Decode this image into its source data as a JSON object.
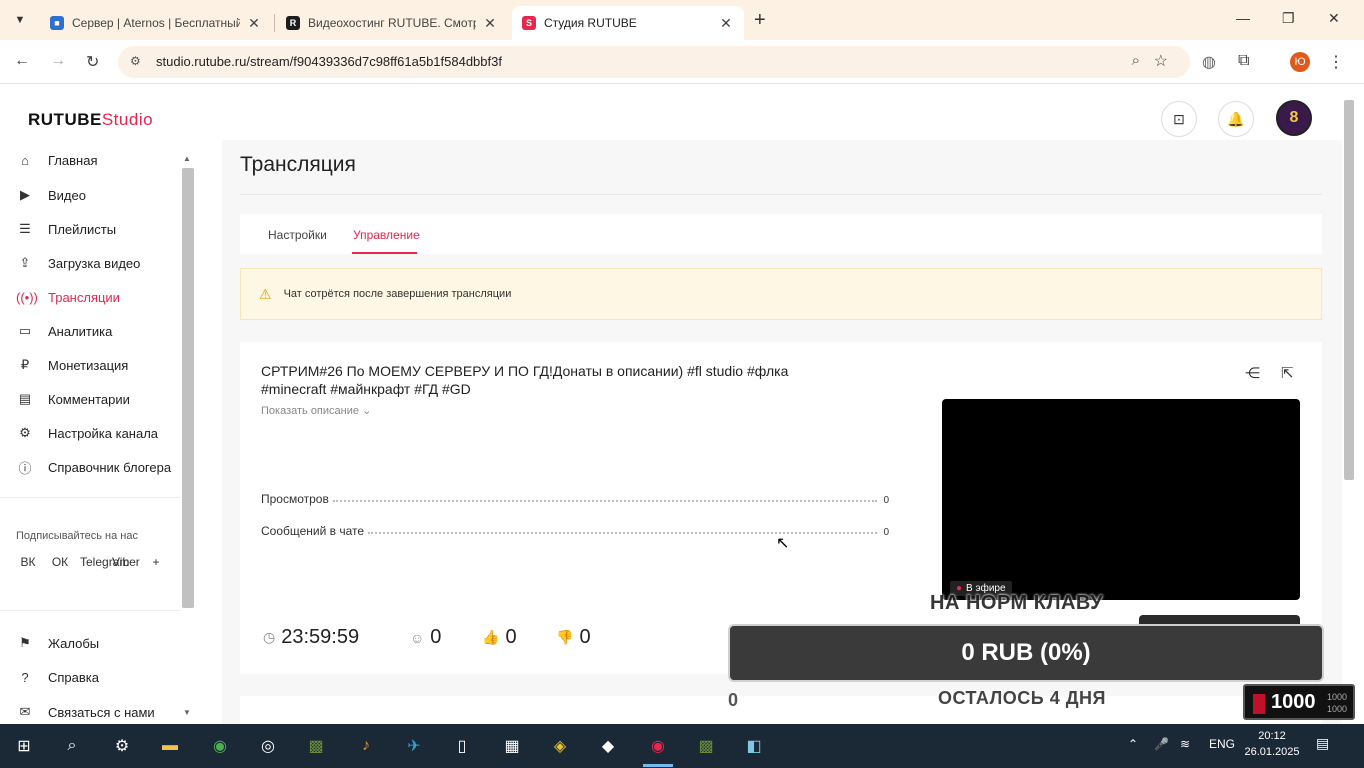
{
  "browser": {
    "tabs": [
      {
        "title": "Сервер | Aternos | Бесплатный",
        "favicon": "aternos-icon",
        "color": "#2f6fd1"
      },
      {
        "title": "Видеохостинг RUTUBE. Смотри",
        "favicon": "rutube-icon",
        "color": "#1d1d1d"
      },
      {
        "title": "Студия RUTUBE",
        "favicon": "rutube-studio-icon",
        "color": "#e8264e"
      }
    ],
    "url": "studio.rutube.ru/stream/f90439336d7c98ff61a5b1f584dbbf3f",
    "profile_letter": "Ю"
  },
  "app": {
    "logo_main": "RUTUBE",
    "logo_sub": "Studio",
    "brand_color": "#e8264e"
  },
  "sidebar": {
    "items": [
      {
        "label": "Главная",
        "icon": "home-icon"
      },
      {
        "label": "Видео",
        "icon": "video-icon"
      },
      {
        "label": "Плейлисты",
        "icon": "playlist-icon"
      },
      {
        "label": "Загрузка видео",
        "icon": "upload-icon"
      },
      {
        "label": "Трансляции",
        "icon": "broadcast-icon",
        "active": true
      },
      {
        "label": "Аналитика",
        "icon": "analytics-icon"
      },
      {
        "label": "Монетизация",
        "icon": "monetization-icon"
      },
      {
        "label": "Комментарии",
        "icon": "comments-icon"
      },
      {
        "label": "Настройка канала",
        "icon": "settings-icon"
      },
      {
        "label": "Справочник блогера",
        "icon": "info-icon"
      }
    ],
    "follow_label": "Подписывайтесь на нас",
    "socials": [
      "ВК",
      "ОК",
      "Telegram",
      "Viber",
      "+"
    ],
    "bottom_items": [
      {
        "label": "Жалобы",
        "icon": "flag-icon"
      },
      {
        "label": "Справка",
        "icon": "help-icon"
      },
      {
        "label": "Связаться с нами",
        "icon": "mail-icon"
      }
    ]
  },
  "main": {
    "title": "Трансляция",
    "tabs": [
      {
        "label": "Настройки"
      },
      {
        "label": "Управление",
        "active": true
      }
    ],
    "warning": "Чат сотрётся после завершения трансляции",
    "stream": {
      "title": "СРТРИМ#26 По МОЕМУ СЕРВЕРУ И ПО ГД!Донаты в описании) #fl studio #флка #minecraft #майнкрафт #ГД #GD",
      "show_description": "Показать описание",
      "stats": [
        {
          "label": "Просмотров",
          "value": "0"
        },
        {
          "label": "Сообщений в чате",
          "value": "0"
        }
      ],
      "live_badge": "В эфире",
      "timer": "23:59:59",
      "viewers": "0",
      "likes": "0",
      "dislikes": "0"
    }
  },
  "overlay": {
    "goal_text": "НА НОРМ КЛАВУ",
    "progress_text": "0 RUB (0%)",
    "progress_fraction": 0,
    "current_amount": "0",
    "time_left": "ОСТАЛОСЬ 4 ДНЯ",
    "counter_big": "1000",
    "counter_small_top": "1000",
    "counter_small_bottom": "1000"
  },
  "taskbar": {
    "lang": "ENG",
    "time": "20:12",
    "date": "26.01.2025"
  }
}
